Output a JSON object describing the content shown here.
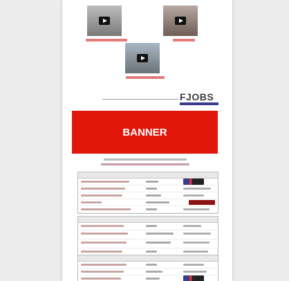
{
  "videos": [
    {
      "caption": ""
    },
    {
      "caption": ""
    },
    {
      "caption": ""
    }
  ],
  "header": {
    "script_logo": "",
    "jobs_logo": "FJOBS"
  },
  "banner": {
    "text": "BANNER"
  },
  "intro": {
    "line1": "",
    "line2": ""
  },
  "tables": [
    {
      "headers": [
        "",
        "",
        ""
      ],
      "rows": [
        [
          "",
          "",
          ""
        ],
        [
          "",
          "",
          ""
        ],
        [
          "",
          "",
          ""
        ],
        [
          "",
          "",
          ""
        ],
        [
          "",
          "",
          ""
        ],
        [
          "",
          "",
          ""
        ]
      ]
    },
    {
      "headers": [
        "",
        "",
        ""
      ],
      "rows": [
        [
          "",
          "",
          ""
        ],
        [
          "",
          "",
          ""
        ],
        [
          "",
          "",
          ""
        ],
        [
          "",
          "",
          ""
        ]
      ]
    },
    {
      "headers": [
        "",
        "",
        ""
      ],
      "rows": [
        [
          "",
          "",
          ""
        ],
        [
          "",
          "",
          ""
        ],
        [
          "",
          "",
          ""
        ]
      ]
    }
  ],
  "colors": {
    "banner": "#e2170b",
    "caption": "#e27b7b",
    "apply_button": "#8e1414",
    "logo_blue": "#3b3b8e"
  }
}
